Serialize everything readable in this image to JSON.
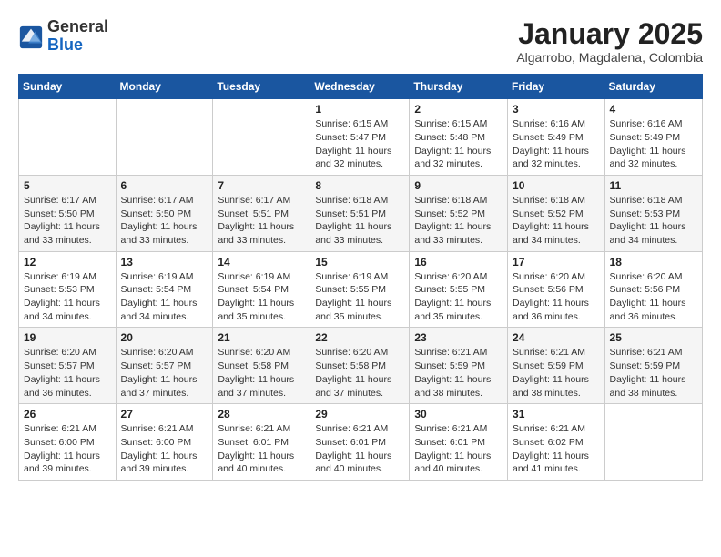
{
  "header": {
    "logo_general": "General",
    "logo_blue": "Blue",
    "month": "January 2025",
    "location": "Algarrobo, Magdalena, Colombia"
  },
  "days_of_week": [
    "Sunday",
    "Monday",
    "Tuesday",
    "Wednesday",
    "Thursday",
    "Friday",
    "Saturday"
  ],
  "weeks": [
    [
      {
        "day": "",
        "detail": ""
      },
      {
        "day": "",
        "detail": ""
      },
      {
        "day": "",
        "detail": ""
      },
      {
        "day": "1",
        "detail": "Sunrise: 6:15 AM\nSunset: 5:47 PM\nDaylight: 11 hours\nand 32 minutes."
      },
      {
        "day": "2",
        "detail": "Sunrise: 6:15 AM\nSunset: 5:48 PM\nDaylight: 11 hours\nand 32 minutes."
      },
      {
        "day": "3",
        "detail": "Sunrise: 6:16 AM\nSunset: 5:49 PM\nDaylight: 11 hours\nand 32 minutes."
      },
      {
        "day": "4",
        "detail": "Sunrise: 6:16 AM\nSunset: 5:49 PM\nDaylight: 11 hours\nand 32 minutes."
      }
    ],
    [
      {
        "day": "5",
        "detail": "Sunrise: 6:17 AM\nSunset: 5:50 PM\nDaylight: 11 hours\nand 33 minutes."
      },
      {
        "day": "6",
        "detail": "Sunrise: 6:17 AM\nSunset: 5:50 PM\nDaylight: 11 hours\nand 33 minutes."
      },
      {
        "day": "7",
        "detail": "Sunrise: 6:17 AM\nSunset: 5:51 PM\nDaylight: 11 hours\nand 33 minutes."
      },
      {
        "day": "8",
        "detail": "Sunrise: 6:18 AM\nSunset: 5:51 PM\nDaylight: 11 hours\nand 33 minutes."
      },
      {
        "day": "9",
        "detail": "Sunrise: 6:18 AM\nSunset: 5:52 PM\nDaylight: 11 hours\nand 33 minutes."
      },
      {
        "day": "10",
        "detail": "Sunrise: 6:18 AM\nSunset: 5:52 PM\nDaylight: 11 hours\nand 34 minutes."
      },
      {
        "day": "11",
        "detail": "Sunrise: 6:18 AM\nSunset: 5:53 PM\nDaylight: 11 hours\nand 34 minutes."
      }
    ],
    [
      {
        "day": "12",
        "detail": "Sunrise: 6:19 AM\nSunset: 5:53 PM\nDaylight: 11 hours\nand 34 minutes."
      },
      {
        "day": "13",
        "detail": "Sunrise: 6:19 AM\nSunset: 5:54 PM\nDaylight: 11 hours\nand 34 minutes."
      },
      {
        "day": "14",
        "detail": "Sunrise: 6:19 AM\nSunset: 5:54 PM\nDaylight: 11 hours\nand 35 minutes."
      },
      {
        "day": "15",
        "detail": "Sunrise: 6:19 AM\nSunset: 5:55 PM\nDaylight: 11 hours\nand 35 minutes."
      },
      {
        "day": "16",
        "detail": "Sunrise: 6:20 AM\nSunset: 5:55 PM\nDaylight: 11 hours\nand 35 minutes."
      },
      {
        "day": "17",
        "detail": "Sunrise: 6:20 AM\nSunset: 5:56 PM\nDaylight: 11 hours\nand 36 minutes."
      },
      {
        "day": "18",
        "detail": "Sunrise: 6:20 AM\nSunset: 5:56 PM\nDaylight: 11 hours\nand 36 minutes."
      }
    ],
    [
      {
        "day": "19",
        "detail": "Sunrise: 6:20 AM\nSunset: 5:57 PM\nDaylight: 11 hours\nand 36 minutes."
      },
      {
        "day": "20",
        "detail": "Sunrise: 6:20 AM\nSunset: 5:57 PM\nDaylight: 11 hours\nand 37 minutes."
      },
      {
        "day": "21",
        "detail": "Sunrise: 6:20 AM\nSunset: 5:58 PM\nDaylight: 11 hours\nand 37 minutes."
      },
      {
        "day": "22",
        "detail": "Sunrise: 6:20 AM\nSunset: 5:58 PM\nDaylight: 11 hours\nand 37 minutes."
      },
      {
        "day": "23",
        "detail": "Sunrise: 6:21 AM\nSunset: 5:59 PM\nDaylight: 11 hours\nand 38 minutes."
      },
      {
        "day": "24",
        "detail": "Sunrise: 6:21 AM\nSunset: 5:59 PM\nDaylight: 11 hours\nand 38 minutes."
      },
      {
        "day": "25",
        "detail": "Sunrise: 6:21 AM\nSunset: 5:59 PM\nDaylight: 11 hours\nand 38 minutes."
      }
    ],
    [
      {
        "day": "26",
        "detail": "Sunrise: 6:21 AM\nSunset: 6:00 PM\nDaylight: 11 hours\nand 39 minutes."
      },
      {
        "day": "27",
        "detail": "Sunrise: 6:21 AM\nSunset: 6:00 PM\nDaylight: 11 hours\nand 39 minutes."
      },
      {
        "day": "28",
        "detail": "Sunrise: 6:21 AM\nSunset: 6:01 PM\nDaylight: 11 hours\nand 40 minutes."
      },
      {
        "day": "29",
        "detail": "Sunrise: 6:21 AM\nSunset: 6:01 PM\nDaylight: 11 hours\nand 40 minutes."
      },
      {
        "day": "30",
        "detail": "Sunrise: 6:21 AM\nSunset: 6:01 PM\nDaylight: 11 hours\nand 40 minutes."
      },
      {
        "day": "31",
        "detail": "Sunrise: 6:21 AM\nSunset: 6:02 PM\nDaylight: 11 hours\nand 41 minutes."
      },
      {
        "day": "",
        "detail": ""
      }
    ]
  ]
}
